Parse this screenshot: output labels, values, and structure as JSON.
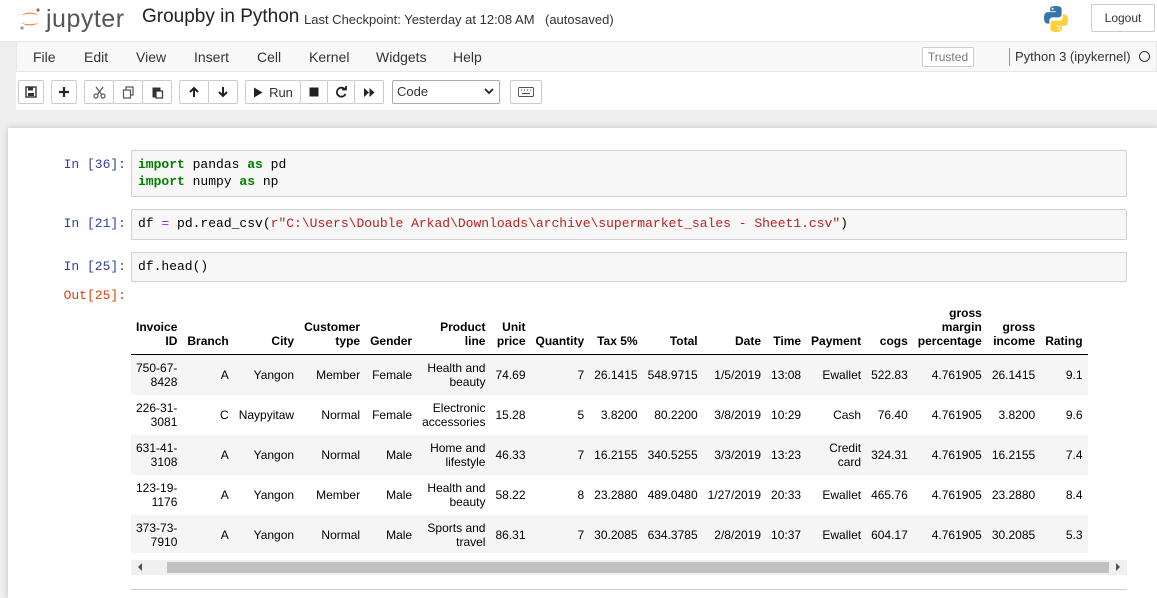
{
  "header": {
    "logo_text": "jupyter",
    "notebook_title": "Groupby in Python",
    "checkpoint": "Last Checkpoint: Yesterday at 12:08 AM",
    "autosave": "(autosaved)",
    "logout_label": "Logout"
  },
  "menubar": {
    "items": [
      "File",
      "Edit",
      "View",
      "Insert",
      "Cell",
      "Kernel",
      "Widgets",
      "Help"
    ],
    "trusted_label": "Trusted",
    "kernel_name": "Python 3 (ipykernel)"
  },
  "toolbar": {
    "run_label": "Run",
    "cell_type": "Code",
    "icons": [
      "save-icon",
      "plus-icon",
      "cut-icon",
      "copy-icon",
      "paste-icon",
      "arrow-up-icon",
      "arrow-down-icon",
      "run-icon",
      "stop-icon",
      "restart-icon",
      "fast-forward-icon",
      "keyboard-icon"
    ]
  },
  "cells": [
    {
      "prompt": "In [36]:",
      "lines": [
        [
          "import",
          " pandas ",
          "as",
          " pd"
        ],
        [
          "import",
          " numpy ",
          "as",
          " np"
        ]
      ]
    },
    {
      "prompt": "In [21]:",
      "code_pre": "df ",
      "code_eq": "=",
      "code_mid": " pd.read_csv(",
      "code_str": "r\"C:\\Users\\Double Arkad\\Downloads\\archive\\supermarket_sales - Sheet1.csv\"",
      "code_post": ")"
    },
    {
      "prompt": "In [25]:",
      "code": "df.head()"
    }
  ],
  "output": {
    "prompt": "Out[25]:",
    "columns": [
      [
        "Invoice",
        "ID"
      ],
      [
        "",
        "Branch"
      ],
      [
        "",
        "City"
      ],
      [
        "Customer",
        "type"
      ],
      [
        "",
        "Gender"
      ],
      [
        "Product",
        "line"
      ],
      [
        "Unit",
        "price"
      ],
      [
        "",
        "Quantity"
      ],
      [
        "",
        "Tax 5%"
      ],
      [
        "",
        "Total"
      ],
      [
        "",
        "Date"
      ],
      [
        "",
        "Time"
      ],
      [
        "",
        "Payment"
      ],
      [
        "",
        "cogs"
      ],
      [
        "gross",
        "margin",
        "percentage"
      ],
      [
        "gross",
        "income"
      ],
      [
        "",
        "Rating"
      ]
    ],
    "rows": [
      [
        [
          "750-67-",
          "8428"
        ],
        [
          "A"
        ],
        [
          "Yangon"
        ],
        [
          "Member"
        ],
        [
          "Female"
        ],
        [
          "Health and",
          "beauty"
        ],
        [
          "74.69"
        ],
        [
          "7"
        ],
        [
          "26.1415"
        ],
        [
          "548.9715"
        ],
        [
          "1/5/2019"
        ],
        [
          "13:08"
        ],
        [
          "Ewallet"
        ],
        [
          "522.83"
        ],
        [
          "4.761905"
        ],
        [
          "26.1415"
        ],
        [
          "9.1"
        ]
      ],
      [
        [
          "226-31-",
          "3081"
        ],
        [
          "C"
        ],
        [
          "Naypyitaw"
        ],
        [
          "Normal"
        ],
        [
          "Female"
        ],
        [
          "Electronic",
          "accessories"
        ],
        [
          "15.28"
        ],
        [
          "5"
        ],
        [
          "3.8200"
        ],
        [
          "80.2200"
        ],
        [
          "3/8/2019"
        ],
        [
          "10:29"
        ],
        [
          "Cash"
        ],
        [
          "76.40"
        ],
        [
          "4.761905"
        ],
        [
          "3.8200"
        ],
        [
          "9.6"
        ]
      ],
      [
        [
          "631-41-",
          "3108"
        ],
        [
          "A"
        ],
        [
          "Yangon"
        ],
        [
          "Normal"
        ],
        [
          "Male"
        ],
        [
          "Home and",
          "lifestyle"
        ],
        [
          "46.33"
        ],
        [
          "7"
        ],
        [
          "16.2155"
        ],
        [
          "340.5255"
        ],
        [
          "3/3/2019"
        ],
        [
          "13:23"
        ],
        [
          "Credit",
          "card"
        ],
        [
          "324.31"
        ],
        [
          "4.761905"
        ],
        [
          "16.2155"
        ],
        [
          "7.4"
        ]
      ],
      [
        [
          "123-19-",
          "1176"
        ],
        [
          "A"
        ],
        [
          "Yangon"
        ],
        [
          "Member"
        ],
        [
          "Male"
        ],
        [
          "Health and",
          "beauty"
        ],
        [
          "58.22"
        ],
        [
          "8"
        ],
        [
          "23.2880"
        ],
        [
          "489.0480"
        ],
        [
          "1/27/2019"
        ],
        [
          "20:33"
        ],
        [
          "Ewallet"
        ],
        [
          "465.76"
        ],
        [
          "4.761905"
        ],
        [
          "23.2880"
        ],
        [
          "8.4"
        ]
      ],
      [
        [
          "373-73-",
          "7910"
        ],
        [
          "A"
        ],
        [
          "Yangon"
        ],
        [
          "Normal"
        ],
        [
          "Male"
        ],
        [
          "Sports and",
          "travel"
        ],
        [
          "86.31"
        ],
        [
          "7"
        ],
        [
          "30.2085"
        ],
        [
          "634.3785"
        ],
        [
          "2/8/2019"
        ],
        [
          "10:37"
        ],
        [
          "Ewallet"
        ],
        [
          "604.17"
        ],
        [
          "4.761905"
        ],
        [
          "30.2085"
        ],
        [
          "5.3"
        ]
      ]
    ]
  }
}
